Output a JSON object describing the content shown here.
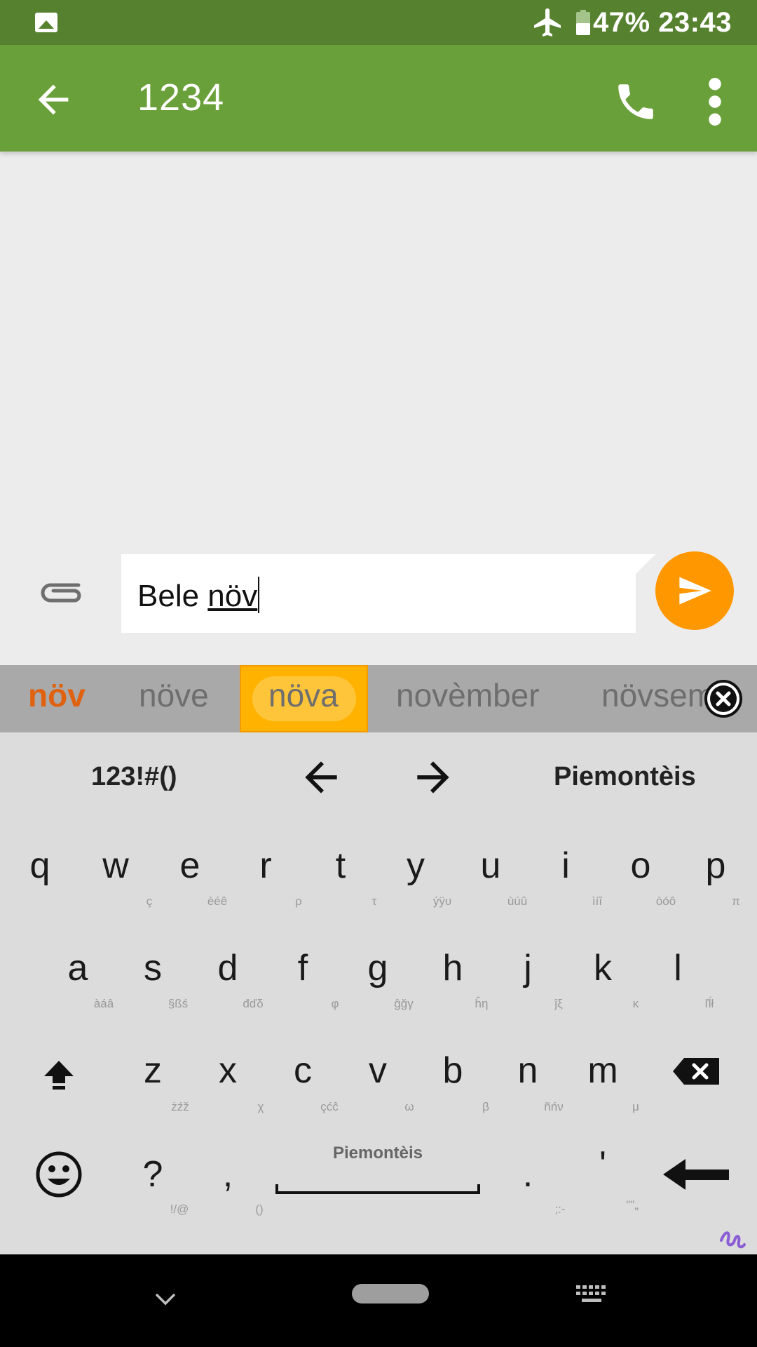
{
  "status_bar": {
    "battery": "47%",
    "time": "23:43",
    "icons": [
      "image-notification-icon",
      "airplane-mode-icon",
      "battery-icon"
    ]
  },
  "app_bar": {
    "title": "1234",
    "icons": [
      "back-arrow-icon",
      "phone-icon",
      "more-vert-icon"
    ]
  },
  "compose": {
    "text_plain": "Bele ",
    "text_composing": "növ",
    "icons": [
      "paperclip-icon",
      "send-icon"
    ],
    "send_color": "#ff9800"
  },
  "suggestions": {
    "items": [
      "növ",
      "növe",
      "növa",
      "novèmber",
      "növsem"
    ],
    "highlighted_index": 2,
    "typed_color": "#e0610f",
    "highlight_color": "#ffb300"
  },
  "keyboard": {
    "toolbar": {
      "symbols": "123!#()",
      "language": "Piemontèis"
    },
    "rows": [
      {
        "keys": [
          "q",
          "w",
          "e",
          "r",
          "t",
          "y",
          "u",
          "i",
          "o",
          "p"
        ],
        "hints": [
          "ç",
          "èéê",
          "ρ",
          "τ",
          "ýÿυ",
          "ùúû",
          "ìíî",
          "òóô",
          "π"
        ]
      },
      {
        "keys": [
          "a",
          "s",
          "d",
          "f",
          "g",
          "h",
          "j",
          "k",
          "l"
        ],
        "hints": [
          "àáâ",
          "§ßś",
          "đďδ",
          "φ",
          "ĝğγ",
          "ĥη",
          "ĵξ",
          "κ",
          "ľĺł"
        ]
      },
      {
        "keys": [
          "z",
          "x",
          "c",
          "v",
          "b",
          "n",
          "m"
        ],
        "hints": [
          "żźž",
          "χ",
          "çćĉ",
          "ω",
          "β",
          "ñńν",
          "μ"
        ]
      }
    ],
    "bottom_row": {
      "question": "?",
      "question_hint": "!/@",
      "comma": ",",
      "comma_hint": "()",
      "space_label": "Piemontèis",
      "period": ".",
      "period_hint": ";:-",
      "apostrophe": "'",
      "apostrophe_hint": "\"\"„"
    }
  },
  "nav_bar": {
    "icons": [
      "nav-hide-keyboard-icon",
      "nav-home-pill",
      "nav-keyboard-switch-icon"
    ]
  }
}
